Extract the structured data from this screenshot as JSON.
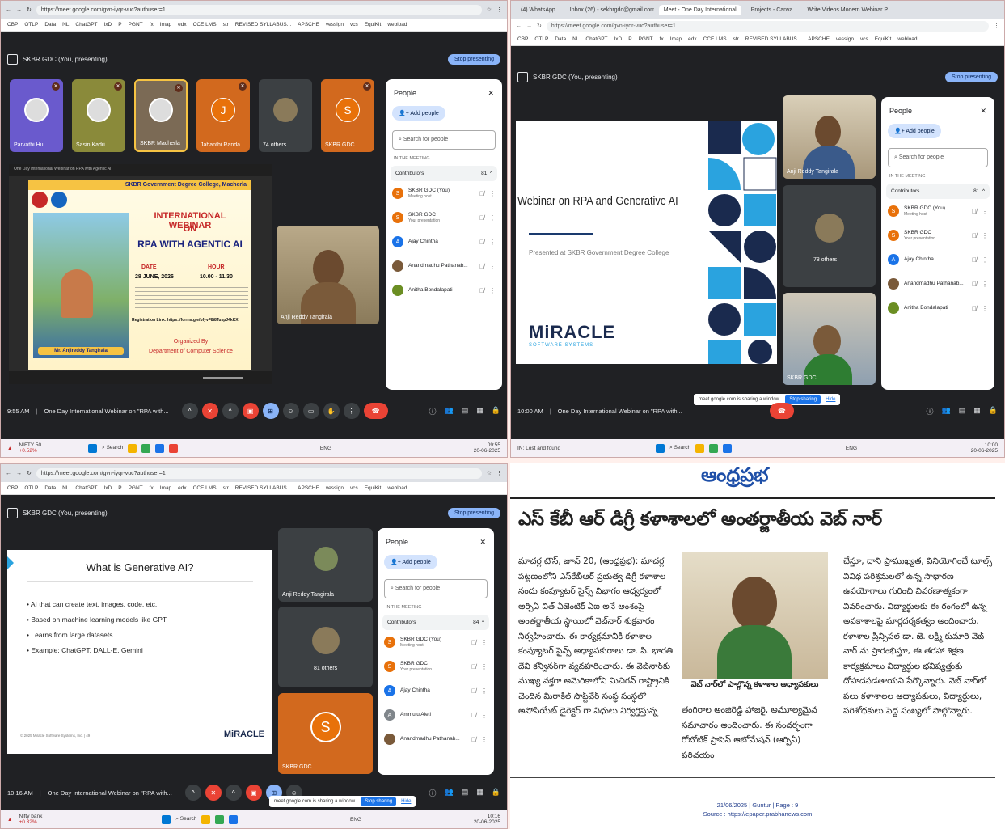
{
  "q1": {
    "url": "https://meet.google.com/gvn-iyqr-vuc?authuser=1",
    "bookmarks": [
      "CBP",
      "OTLP",
      "Data",
      "NL",
      "ChatGPT",
      "IxD",
      "P",
      "PGNT",
      "fx",
      "Imap",
      "edx",
      "CCE LMS",
      "str",
      "REVISED SYLLABUS...",
      "APSCHE",
      "vessign",
      "vcs",
      "EquiKit",
      "webload"
    ],
    "presenting": "SKBR GDC (You, presenting)",
    "stop_presenting": "Stop presenting",
    "tiles": [
      {
        "name": "Parvathi Hul",
        "kind": "photo",
        "color": "#6a5acd"
      },
      {
        "name": "Sasin Kadri",
        "kind": "photo",
        "color": "#8a8a3a"
      },
      {
        "name": "SKBR Macherla",
        "kind": "photo",
        "color": "#7b6a55"
      },
      {
        "name": "Jahanthi Randa",
        "kind": "letter",
        "letter": "J",
        "color": "#e8710a"
      },
      {
        "name": "74 others",
        "kind": "group",
        "color": "#3c4043"
      },
      {
        "name": "SKBR GDC",
        "kind": "letter",
        "letter": "S",
        "color": "#e8710a"
      }
    ],
    "poster": {
      "college": "SKBR Government Degree College, Macherla",
      "line1": "INTERNATIONAL WEBINAR",
      "line2": "ON",
      "line3": "RPA WITH AGENTIC AI",
      "date_label": "DATE",
      "date": "28 JUNE, 2026",
      "hour_label": "HOUR",
      "hour": "10.00 - 11.30",
      "speaker": "Mr. Anjireddy Tangirala",
      "reg": "Registration Link: https://forms.gle/bfyvF8i8TuspJ4kKX",
      "org1": "Organized By",
      "org2": "Department of Computer Science"
    },
    "speaker_name": "Anji Reddy Tangirala",
    "people": {
      "title": "People",
      "add": "Add people",
      "search": "Search for people",
      "section": "IN THE MEETING",
      "contrib": "Contributors",
      "count": "81",
      "rows": [
        {
          "name": "SKBR GDC (You)",
          "sub": "Meeting host",
          "letter": "S",
          "color": "#e8710a"
        },
        {
          "name": "SKBR GDC",
          "sub": "Your presentation",
          "letter": "S",
          "color": "#e8710a"
        },
        {
          "name": "Ajay Chintha",
          "sub": "",
          "letter": "A",
          "color": "#1a73e8"
        },
        {
          "name": "Anandmadhu Pathanab...",
          "sub": "",
          "letter": "",
          "color": "#7a5a3a"
        },
        {
          "name": "Anitha Bondalapati",
          "sub": "",
          "letter": "",
          "color": "#6b8e23"
        }
      ]
    },
    "time": "9:55 AM",
    "meeting": "One Day International Webinar on \"RPA with...",
    "task": {
      "weather": "NIFTY 50",
      "weather2": "+0.52%",
      "search": "Search",
      "date": "20-06-2025",
      "clock": "09:55",
      "lang": "ENG"
    }
  },
  "q2": {
    "url": "https://meet.google.com/gvn-iyqr-vuc?authuser=1",
    "tabs": [
      "(4) WhatsApp",
      "Inbox (26) - sekbrgdc@gmail.com",
      "Meet - One Day International",
      "Projects - Canva",
      "Write Videos Modern Webinar P..."
    ],
    "presenting": "SKBR GDC (You, presenting)",
    "stop_presenting": "Stop presenting",
    "slide_title": "Webinar on RPA and Generative AI",
    "slide_sub": "Presented at SKBR Government Degree College",
    "logo": "MiRACLE",
    "logo_sub": "SOFTWARE SYSTEMS",
    "tiles": [
      {
        "name": "Anji Reddy Tangirala"
      },
      {
        "name": "78 others"
      },
      {
        "name": "SKBR GDC"
      }
    ],
    "people": {
      "title": "People",
      "add": "Add people",
      "search": "Search for people",
      "section": "IN THE MEETING",
      "contrib": "Contributors",
      "count": "81",
      "rows": [
        {
          "name": "SKBR GDC (You)",
          "sub": "Meeting host",
          "letter": "S",
          "color": "#e8710a"
        },
        {
          "name": "SKBR GDC",
          "sub": "Your presentation",
          "letter": "S",
          "color": "#e8710a"
        },
        {
          "name": "Ajay Chintha",
          "sub": "",
          "letter": "A",
          "color": "#1a73e8"
        },
        {
          "name": "Anandmadhu Pathanab...",
          "sub": "",
          "letter": "",
          "color": "#7a5a3a"
        },
        {
          "name": "Anitha Bondalapati",
          "sub": "",
          "letter": "",
          "color": "#6b8e23"
        }
      ]
    },
    "share": {
      "text": "meet.google.com is sharing a window.",
      "stop": "Stop sharing",
      "hide": "Hide"
    },
    "time": "10:00 AM",
    "meeting": "One Day International Webinar on \"RPA with...",
    "task": {
      "weather": "IN: Lost and found",
      "weather2": "",
      "search": "Search",
      "date": "20-06-2025",
      "clock": "10:00",
      "lang": "ENG"
    }
  },
  "q3": {
    "url": "https://meet.google.com/gvn-iyqr-vuc?authuser=1",
    "presenting": "SKBR GDC (You, presenting)",
    "stop_presenting": "Stop presenting",
    "slide_title": "What is Generative AI?",
    "bullets": [
      "AI that can create text, images, code, etc.",
      "Based on machine learning models like GPT",
      "Learns from large datasets",
      "Example: ChatGPT, DALL-E, Gemini"
    ],
    "copyright": "© 2025 Miracle Software Systems, Inc. | 49",
    "logo": "MiRACLE",
    "tiles": [
      {
        "name": "Anji Reddy Tangirala"
      },
      {
        "name": "81 others"
      },
      {
        "name": "SKBR GDC",
        "letter": "S"
      }
    ],
    "people": {
      "title": "People",
      "add": "Add people",
      "search": "Search for people",
      "section": "IN THE MEETING",
      "contrib": "Contributors",
      "count": "84",
      "rows": [
        {
          "name": "SKBR GDC (You)",
          "sub": "Meeting host",
          "letter": "S",
          "color": "#e8710a"
        },
        {
          "name": "SKBR GDC",
          "sub": "Your presentation",
          "letter": "S",
          "color": "#e8710a"
        },
        {
          "name": "Ajay Chintha",
          "sub": "",
          "letter": "A",
          "color": "#1a73e8"
        },
        {
          "name": "Ammulu Aleti",
          "sub": "",
          "letter": "A",
          "color": "#80868b"
        },
        {
          "name": "Anandmadhu Pathanab...",
          "sub": "",
          "letter": "",
          "color": "#7a5a3a"
        }
      ]
    },
    "share": {
      "text": "meet.google.com is sharing a window.",
      "stop": "Stop sharing",
      "hide": "Hide"
    },
    "time": "10:16 AM",
    "meeting": "One Day International Webinar on \"RPA with...",
    "task": {
      "weather": "Nifty bank",
      "weather2": "+0.32%",
      "search": "Search",
      "date": "20-06-2025",
      "clock": "10:16",
      "lang": "ENG"
    }
  },
  "paper": {
    "masthead": "ఆంధ్రప్రభ",
    "headline": "ఎస్ కేబీ ఆర్ డిగ్రీ కళాశాలలో అంతర్జాతీయ వెబ్ నార్",
    "col1": "మాచర్ల టౌన్, జూన్ 20, (ఆంధ్రప్రభ): మాచర్ల పట్టణంలోని ఎస్‌కేబీఆర్ ప్రభుత్వ డిగ్రీ కళాశాల నందు కంప్యూటర్ సైన్స్ విభాగం ఆధ్వర్యంలో ఆర్పిఏ విత్ ఏజెంటిక్ ఏఐ అనే అంశంపై అంతర్జాతీయ స్థాయిలో వెబ్‌నార్ శుక్రవారం నిర్వహించారు. ఈ కార్యక్రమానికి కళాశాల కంప్యూటర్ సైన్స్ అధ్యాపకురాలు డా. పి. భారతి దేవి కన్వీనర్‌గా వ్యవహరించారు. ఈ వెబ్‌నార్‌కు ముఖ్య వక్తగా అమెరికాలోని మిచిగన్ రాష్ట్రానికి చెందిన మిరాకిల్ సాఫ్ట్‌వేర్ సంస్థ సంస్థలో అసోసియేట్ డైరెక్టర్ గా విధులు నిర్వర్తిస్తున్న",
    "caption": "వెబ్ నార్‌లో పాల్గొన్న కళాశాల అధ్యాపకులు",
    "col2b": "తంగిరాల అంజిరెడ్డి హాజరై, అమూల్యమైన సమాచారం అందించారు. ఈ సందర్భంగా రోబోటిక్ ప్రాసెస్ ఆటోమేషన్ (ఆర్పిఏ) పరిచయం",
    "col3": "చేస్తూ, దాని ప్రాముఖ్యత, వినియోగించే టూల్స్ వివిధ పరిశ్రమలలో ఉన్న సాధారణ ఉపయోగాలు గురించి వివరణాత్మకంగా వివరించారు. విద్యార్థులకు ఈ రంగంలో ఉన్న అవకాశాలపై మార్గదర్శకత్వం అందించారు. కళాశాల ప్రిన్సిపల్ డా. జె. లక్ష్మీ కుమారి వెబ్ నార్ ను ప్రారంభిస్తూ, ఈ తరహా శిక్షణ కార్యక్రమాలు విద్యార్థుల భవిష్యత్తుకు దోహదపడతాయని పేర్కొన్నారు. వెబ్ నార్‌లో పలు కళాశాలల అధ్యాపకులు, విద్యార్థులు, పరిశోధకులు పెద్ద సంఖ్యలో పాల్గొన్నారు.",
    "dateline": "21/06/2025 | Guntur | Page : 9",
    "source": "Source : https://epaper.prabhanews.com"
  }
}
